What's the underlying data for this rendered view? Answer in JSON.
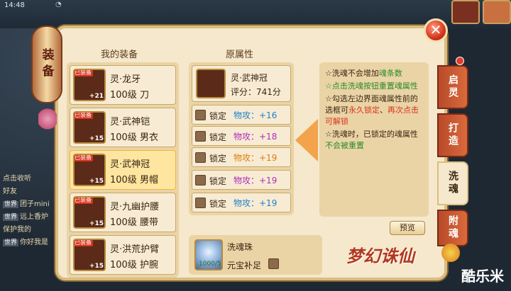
{
  "status": {
    "time": "14:48"
  },
  "lantern": {
    "title": "装备"
  },
  "list": {
    "title": "我的装备",
    "items": [
      {
        "name": "灵·龙牙",
        "desc": "100级 刀",
        "tag": "已装备",
        "level": "+21",
        "selected": false
      },
      {
        "name": "灵·武神铠",
        "desc": "100级 男衣",
        "tag": "已装备",
        "level": "+15",
        "selected": false
      },
      {
        "name": "灵·武神冠",
        "desc": "100级 男帽",
        "tag": "已装备",
        "level": "+15",
        "selected": true
      },
      {
        "name": "灵·九幽护腰",
        "desc": "100级 腰带",
        "tag": "已装备",
        "level": "+15",
        "selected": false
      },
      {
        "name": "灵·洪荒护臂",
        "desc": "100级 护腕",
        "tag": "已装备",
        "level": "+15",
        "selected": false
      }
    ]
  },
  "attrs": {
    "title": "原属性",
    "item_name": "灵·武神冠",
    "score": "评分：741分",
    "lock_label": "锁定",
    "rows": [
      {
        "stat": "物攻：+16",
        "color": "#1f7fc8"
      },
      {
        "stat": "物攻：+18",
        "color": "#b02cb8"
      },
      {
        "stat": "物攻：+19",
        "color": "#e07a12"
      },
      {
        "stat": "物攻：+19",
        "color": "#b02cb8"
      },
      {
        "stat": "物攻：+19",
        "color": "#1f7fc8"
      }
    ]
  },
  "tips": {
    "t1a": "☆洗魂不会增加",
    "t1b": "魂条数",
    "t2": "☆点击洗魂按钮重置魂属性",
    "t3a": "☆勾选左边界面魂属性前的选框可",
    "t3b": "永久锁定",
    "t3c": "、",
    "t3d": "再次点击可解锁",
    "t4a": "☆洗魂时，已锁定的魂属性",
    "t4b": "不会被重置"
  },
  "preview_label": "预览",
  "pearl": {
    "name": "洗魂珠",
    "count": "1000/5",
    "supplement": "元宝补足"
  },
  "tabs": [
    {
      "label": "启灵"
    },
    {
      "label": "打造"
    },
    {
      "label": "洗魂"
    },
    {
      "label": "附魂"
    }
  ],
  "logo": "梦幻诛仙",
  "site": "酷乐米",
  "bottom_left": [
    "点击收听",
    "好友",
    "团子mini",
    "远上香炉",
    "保护我的",
    "你好我是"
  ],
  "bl_tag": "世界",
  "colors": {
    "blue": "#1f7fc8",
    "purple": "#b02cb8",
    "orange": "#e07a12",
    "green": "#2a8a2a"
  }
}
